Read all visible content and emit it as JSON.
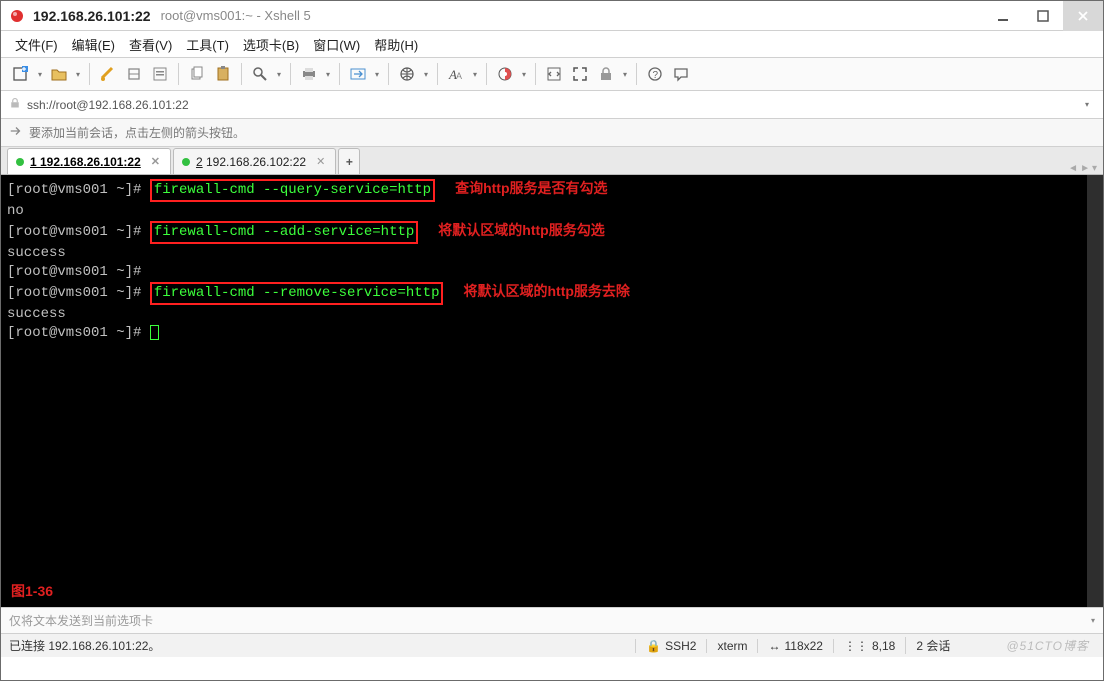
{
  "title": {
    "host": "192.168.26.101:22",
    "sub": "root@vms001:~ - Xshell 5"
  },
  "menu": {
    "file": "文件(F)",
    "edit": "编辑(E)",
    "view": "查看(V)",
    "tools": "工具(T)",
    "tabs": "选项卡(B)",
    "window": "窗口(W)",
    "help": "帮助(H)"
  },
  "address": "ssh://root@192.168.26.101:22",
  "hint": "要添加当前会话，点击左侧的箭头按钮。",
  "tabs": [
    {
      "label": "1 192.168.26.101:22",
      "active": true
    },
    {
      "label": "2 192.168.26.102:22",
      "active": false
    }
  ],
  "term": {
    "p1": "[root@vms001 ~]# ",
    "c1": "firewall-cmd --query-service=http",
    "a1": "查询http服务是否有勾选",
    "o1": "no",
    "p2": "[root@vms001 ~]# ",
    "c2": "firewall-cmd --add-service=http",
    "a2": "将默认区域的http服务勾选",
    "o2": "success",
    "p3": "[root@vms001 ~]# ",
    "p3b": "[root@vms001 ~]# ",
    "c3": "firewall-cmd --remove-service=http",
    "a3": "将默认区域的http服务去除",
    "o3": "success",
    "p4": "[root@vms001 ~]# ",
    "fig": "图1-36"
  },
  "sendbar": "仅将文本发送到当前选项卡",
  "status": {
    "conn": "已连接 192.168.26.101:22。",
    "proto": "SSH2",
    "term": "xterm",
    "size": "118x22",
    "cursor": "8,18",
    "session": "2 会话"
  },
  "watermark": "@51CTO博客"
}
